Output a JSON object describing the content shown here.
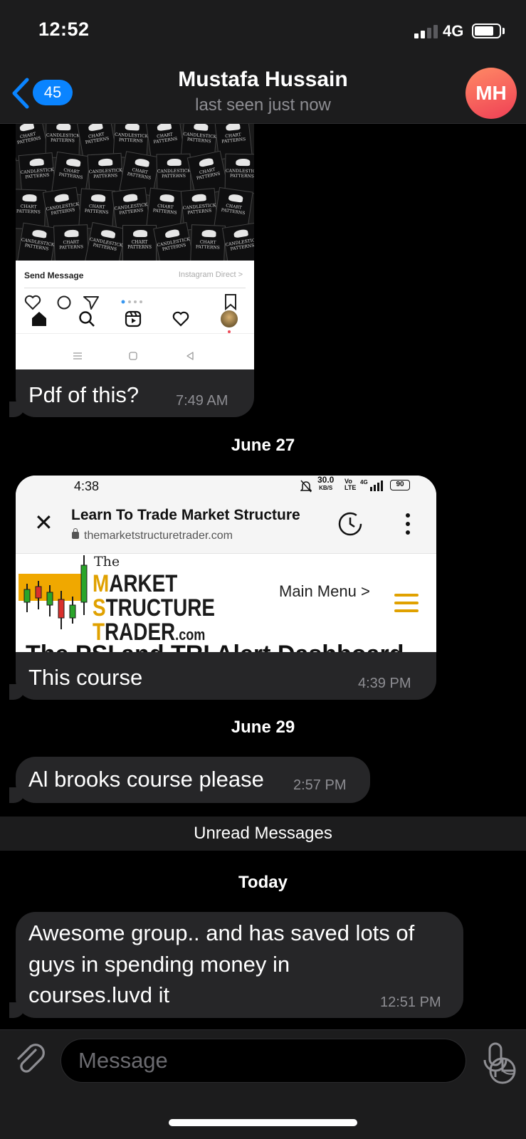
{
  "status_bar": {
    "time": "12:52",
    "network": "4G"
  },
  "header": {
    "back_count": "45",
    "name": "Mustafa Hussain",
    "subtitle": "last seen just now",
    "avatar_initials": "MH",
    "colors": {
      "accent": "#0a84ff",
      "avatar_from": "#ff8a65",
      "avatar_to": "#ef3f55"
    }
  },
  "messages": [
    {
      "image": {
        "kind": "instagram-screenshot",
        "card_label_a": "CHART PATTERNS",
        "card_label_b": "CANDLESTICK PATTERNS",
        "send_message": "Send Message",
        "instagram_direct": "Instagram Direct >"
      },
      "text": "Pdf  of this?",
      "time": "7:49 AM"
    },
    {
      "date": "June 27",
      "image": {
        "kind": "browser-screenshot",
        "time": "4:38",
        "status_speed": "30.0",
        "status_unit": "KB/S",
        "status_battery": "90",
        "page_title": "Learn To Trade Market Structure",
        "url": "themarketstructuretrader.com",
        "logo_the": "The",
        "logo_line1_initial": "M",
        "logo_line1_rest": "ARKET",
        "logo_line2_initial": "S",
        "logo_line2_rest": "TRUCTURE",
        "logo_line3_initial": "T",
        "logo_line3_rest": "RADER",
        "logo_suffix": ".com",
        "menu_label": "Main Menu >",
        "cut_off_heading": "The PSI and TRI Alert Dashboard"
      },
      "text": "This course",
      "time": "4:39 PM"
    },
    {
      "date": "June 29",
      "text": "Al brooks course please",
      "time": "2:57 PM"
    }
  ],
  "unread_label": "Unread Messages",
  "today": {
    "date": "Today",
    "lines": [
      "Awesome group.. and has saved lots of",
      "guys in spending money in",
      "courses.luvd it"
    ],
    "time": "12:51 PM"
  },
  "composer": {
    "placeholder": "Message"
  }
}
